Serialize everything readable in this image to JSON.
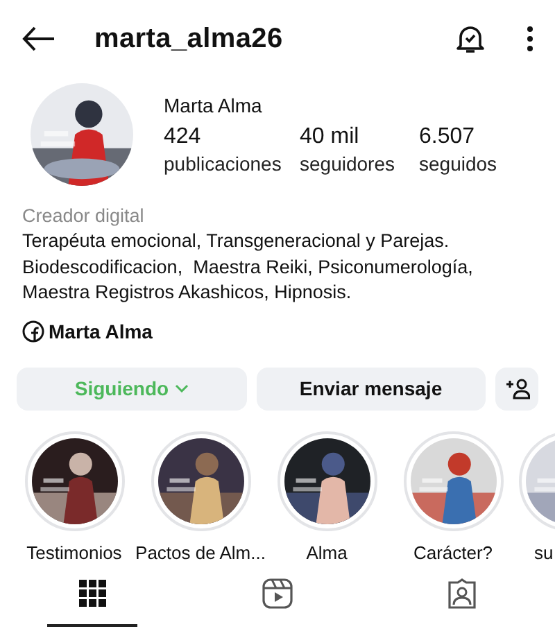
{
  "header": {
    "username": "marta_alma26"
  },
  "profile": {
    "name": "Marta Alma",
    "stats": [
      {
        "value": "424",
        "label": "publicaciones"
      },
      {
        "value": "40 mil",
        "label": "seguidores"
      },
      {
        "value": "6.507",
        "label": "seguidos"
      }
    ],
    "category": "Creador digital",
    "bio": [
      "Terapéuta emocional, Transgeneracional y Parejas.",
      "Biodescodificacion,  Maestra Reiki, Psiconumerología,",
      "Maestra Registros Akashicos, Hipnosis."
    ],
    "link": "Marta Alma"
  },
  "buttons": [
    {
      "kind": "following",
      "label": "Siguiendo"
    },
    {
      "kind": "message",
      "label": "Enviar mensaje"
    },
    {
      "kind": "add-person"
    }
  ],
  "highlights": [
    {
      "label": "Testimonios",
      "clipped": false
    },
    {
      "label": "Pactos de Alm...",
      "clipped": false
    },
    {
      "label": "Alma",
      "clipped": false
    },
    {
      "label": "Carácter?",
      "clipped": false
    },
    {
      "label": "su",
      "clipped": true
    }
  ],
  "tabs": [
    {
      "kind": "grid",
      "selected": true
    },
    {
      "kind": "reels",
      "selected": false
    },
    {
      "kind": "tagged",
      "selected": false
    }
  ]
}
